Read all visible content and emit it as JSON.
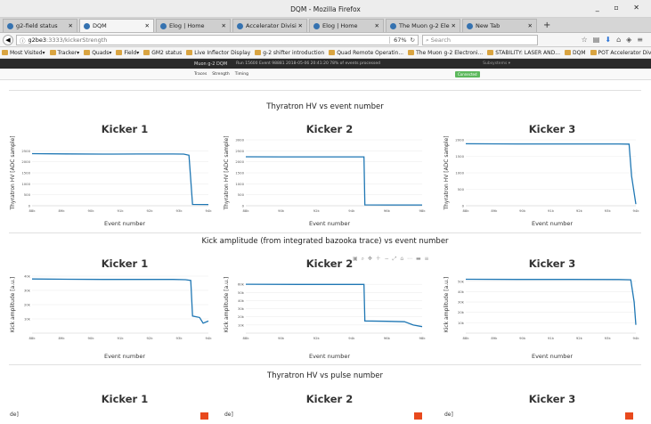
{
  "window": {
    "title": "DQM - Mozilla Firefox",
    "controls": "_ ▫ ✕"
  },
  "tabs": [
    {
      "label": "g2-field status",
      "active": false
    },
    {
      "label": "DQM",
      "active": true
    },
    {
      "label": "Elog | Home",
      "active": false
    },
    {
      "label": "Accelerator Division N...",
      "active": false
    },
    {
      "label": "Elog | Home",
      "active": false
    },
    {
      "label": "The Muon g-2 Electronic ...",
      "active": false
    },
    {
      "label": "New Tab",
      "active": false
    }
  ],
  "navbar": {
    "url_host": "g2be3",
    "url_path": ":3333/kickerStrength",
    "zoom": "67%",
    "search_placeholder": "Search"
  },
  "bookmarks": [
    "Most Visited▾",
    "Tracker▾",
    "Quads▾",
    "Field▾",
    "GM2 status",
    "Live Inflector Display",
    "g-2 shifter introduction",
    "Quad Remote Operatin...",
    "The Muon g-2 Electroni...",
    "STABILITY: LASER AND...",
    "DQM",
    "POT Accelerator Divisio..."
  ],
  "app": {
    "brand": "Muon g-2 DQM",
    "run_info": "Run 15600 Event 98881   2018-05-06 20:41:20   78% of events processed",
    "subsystems": "Subsystems ▾",
    "nav": [
      "Traces",
      "Strength",
      "Timing"
    ],
    "status": "Connected"
  },
  "sections": [
    {
      "title": "Thyratron HV vs event number"
    },
    {
      "title": "Kick amplitude (from integrated bazooka trace) vs event number"
    },
    {
      "title": "Thyratron HV vs pulse number"
    }
  ],
  "kicker_titles": [
    "Kicker 1",
    "Kicker 2",
    "Kicker 3"
  ],
  "xlabels": {
    "event": "Event number"
  },
  "ylabels": {
    "hv": "Thyratron HV [ADC sample]",
    "amp": "Kick amplitude [a.u.]"
  },
  "colors": {
    "series": "#1f77b4",
    "accent": "#e8491d",
    "connected": "#5cb85c"
  },
  "chart_data": [
    {
      "type": "line",
      "title": "Kicker 1",
      "xlabel": "Event number",
      "ylabel": "Thyratron HV [ADC sample]",
      "ylim": [
        0,
        3000
      ],
      "yticks": [
        "0",
        "500",
        "1000",
        "1500",
        "2000",
        "2500"
      ],
      "xticks": [
        "88k",
        "89k",
        "90k",
        "91k",
        "92k",
        "93k",
        "94k"
      ],
      "x": [
        0.0,
        0.2,
        0.4,
        0.6,
        0.8,
        0.86,
        0.89,
        0.91,
        1.0
      ],
      "y": [
        2370,
        2360,
        2350,
        2355,
        2355,
        2350,
        2300,
        60,
        55
      ]
    },
    {
      "type": "line",
      "title": "Kicker 2",
      "xlabel": "Event number",
      "ylabel": "Thyratron HV [ADC sample]",
      "ylim": [
        0,
        3000
      ],
      "yticks": [
        "0",
        "500",
        "1000",
        "1500",
        "2000",
        "2500",
        "3000"
      ],
      "xticks": [
        "88k",
        "90k",
        "92k",
        "94k",
        "96k",
        "98k"
      ],
      "x": [
        0.0,
        0.2,
        0.4,
        0.6,
        0.67,
        0.675,
        0.8,
        1.0
      ],
      "y": [
        2230,
        2225,
        2225,
        2225,
        2225,
        40,
        35,
        35
      ]
    },
    {
      "type": "line",
      "title": "Kicker 3",
      "xlabel": "Event number",
      "ylabel": "Thyratron HV [ADC sample]",
      "ylim": [
        0,
        2000
      ],
      "yticks": [
        "0",
        "500",
        "1000",
        "1500",
        "2000"
      ],
      "xticks": [
        "88k",
        "89k",
        "90k",
        "91k",
        "92k",
        "93k",
        "94k"
      ],
      "x": [
        0.0,
        0.3,
        0.6,
        0.9,
        0.96,
        0.975,
        1.0
      ],
      "y": [
        1880,
        1875,
        1875,
        1875,
        1870,
        900,
        50
      ]
    },
    {
      "type": "line",
      "title": "Kicker 1",
      "xlabel": "Event number",
      "ylabel": "Kick amplitude [a.u.]",
      "ylim": [
        0,
        40000
      ],
      "yticks": [
        "10k",
        "20k",
        "30k",
        "40k"
      ],
      "xticks": [
        "88k",
        "89k",
        "90k",
        "91k",
        "92k",
        "93k",
        "94k"
      ],
      "x": [
        0.0,
        0.2,
        0.4,
        0.6,
        0.8,
        0.87,
        0.9,
        0.91,
        0.95,
        0.97,
        1.0
      ],
      "y": [
        38000,
        37800,
        37700,
        37700,
        37700,
        37500,
        37000,
        12000,
        11000,
        7000,
        8500
      ]
    },
    {
      "type": "line",
      "title": "Kicker 2",
      "xlabel": "Event number",
      "ylabel": "Kick amplitude [a.u.]",
      "ylim": [
        0,
        70000
      ],
      "yticks": [
        "10k",
        "20k",
        "30k",
        "40k",
        "50k",
        "60k"
      ],
      "xticks": [
        "88k",
        "90k",
        "92k",
        "94k",
        "96k",
        "98k"
      ],
      "x": [
        0.0,
        0.3,
        0.6,
        0.67,
        0.675,
        0.8,
        0.9,
        0.95,
        1.0
      ],
      "y": [
        60000,
        59800,
        59800,
        59800,
        15000,
        14500,
        14000,
        10000,
        8000
      ]
    },
    {
      "type": "line",
      "title": "Kicker 3",
      "xlabel": "Event number",
      "ylabel": "Kick amplitude [a.u.]",
      "ylim": [
        0,
        55000
      ],
      "yticks": [
        "10k",
        "20k",
        "30k",
        "40k",
        "50k"
      ],
      "xticks": [
        "88k",
        "89k",
        "90k",
        "91k",
        "92k",
        "93k",
        "94k"
      ],
      "x": [
        0.0,
        0.3,
        0.6,
        0.9,
        0.97,
        0.99,
        1.0
      ],
      "y": [
        52000,
        51800,
        51800,
        51700,
        51500,
        30000,
        8000
      ]
    }
  ]
}
